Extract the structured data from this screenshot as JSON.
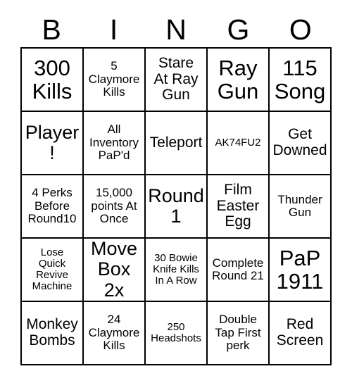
{
  "card": {
    "title": "BINGO",
    "header_letters": [
      "B",
      "I",
      "N",
      "G",
      "O"
    ],
    "grid_size": "5x5",
    "text_color": "#000000",
    "background_color": "#ffffff",
    "border_color": "#000000",
    "rows": [
      [
        {
          "text": "300\nKills",
          "size": "xl"
        },
        {
          "text": "5\nClaymore\nKills",
          "size": "sm"
        },
        {
          "text": "Stare\nAt Ray\nGun",
          "size": "md"
        },
        {
          "text": "Ray\nGun",
          "size": "xl"
        },
        {
          "text": "115\nSong",
          "size": "xl"
        }
      ],
      [
        {
          "text": "Player!",
          "size": "lg"
        },
        {
          "text": "All\nInventory\nPaP'd",
          "size": "sm"
        },
        {
          "text": "Teleport",
          "size": "md"
        },
        {
          "text": "AK74FU2",
          "size": "xs"
        },
        {
          "text": "Get\nDowned",
          "size": "md"
        }
      ],
      [
        {
          "text": "4 Perks\nBefore\nRound10",
          "size": "sm"
        },
        {
          "text": "15,000\npoints At\nOnce",
          "size": "sm"
        },
        {
          "text": "Round\n1",
          "size": "lg"
        },
        {
          "text": "Film\nEaster\nEgg",
          "size": "md"
        },
        {
          "text": "Thunder\nGun",
          "size": "sm"
        }
      ],
      [
        {
          "text": "Lose\nQuick\nRevive\nMachine",
          "size": "xs"
        },
        {
          "text": "Move\nBox 2x",
          "size": "lg"
        },
        {
          "text": "30 Bowie\nKnife Kills\nIn A Row",
          "size": "xs"
        },
        {
          "text": "Complete\nRound 21",
          "size": "sm"
        },
        {
          "text": "PaP\n1911",
          "size": "xl"
        }
      ],
      [
        {
          "text": "Monkey\nBombs",
          "size": "md"
        },
        {
          "text": "24\nClaymore\nKills",
          "size": "sm"
        },
        {
          "text": "250\nHeadshots",
          "size": "xs"
        },
        {
          "text": "Double\nTap First\nperk",
          "size": "sm"
        },
        {
          "text": "Red\nScreen",
          "size": "md"
        }
      ]
    ]
  }
}
